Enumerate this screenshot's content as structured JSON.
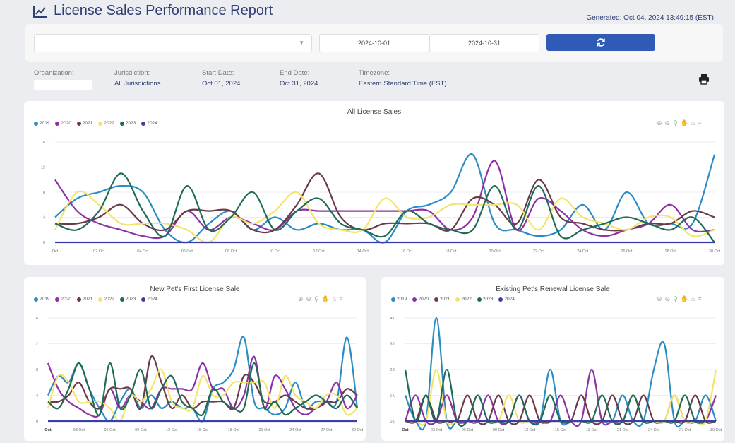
{
  "header": {
    "title": "License Sales Performance Report",
    "generated": "Generated: Oct 04, 2024 13:49:15 (EST)"
  },
  "filters": {
    "start_date_value": "2024-10-01",
    "end_date_value": "2024-10-31"
  },
  "meta": {
    "organization_label": "Organization:",
    "jurisdiction_label": "Jurisdiction:",
    "jurisdiction_value": "All Jurisdictions",
    "start_label": "Start Date:",
    "start_value": "Oct 01, 2024",
    "end_label": "End Date:",
    "end_value": "Oct 31, 2024",
    "timezone_label": "Timezone:",
    "timezone_value": "Eastern Standard Time (EST)"
  },
  "colors": {
    "2019": "#2b8cc4",
    "2020": "#8e30a8",
    "2021": "#6b3a4a",
    "2022": "#f2e56a",
    "2023": "#1f6b57",
    "2024": "#3a3ea8"
  },
  "chart_data": [
    {
      "type": "line",
      "title": "All License Sales",
      "x_ticks": [
        "Oct",
        "02 Oct",
        "04 Oct",
        "06 Oct",
        "08 Oct",
        "10 Oct",
        "12 Oct",
        "14 Oct",
        "16 Oct",
        "18 Oct",
        "20 Oct",
        "22 Oct",
        "24 Oct",
        "26 Oct",
        "28 Oct",
        "30 Oct"
      ],
      "y_ticks": [
        "0",
        "4",
        "8",
        "12",
        "16"
      ],
      "ylim": [
        0,
        16
      ],
      "x": [
        1,
        2,
        3,
        4,
        5,
        6,
        7,
        8,
        9,
        10,
        11,
        12,
        13,
        14,
        15,
        16,
        17,
        18,
        19,
        20,
        21,
        22,
        23,
        24,
        25,
        26,
        27,
        28,
        29,
        30,
        31
      ],
      "series": [
        {
          "name": "2019",
          "values": [
            4,
            7,
            8,
            9,
            8,
            2,
            0,
            3,
            5,
            2,
            4,
            2,
            3,
            2,
            2,
            0,
            5,
            6,
            8,
            14,
            3,
            2,
            1,
            2,
            6,
            2,
            8,
            3,
            3,
            3,
            14
          ]
        },
        {
          "name": "2020",
          "values": [
            10,
            5,
            3,
            2,
            1,
            1,
            5,
            2,
            4,
            3,
            2,
            5,
            5,
            5,
            5,
            5,
            5,
            5,
            2,
            4,
            13,
            2,
            7,
            5,
            2,
            1,
            2,
            3,
            6,
            2,
            2
          ]
        },
        {
          "name": "2021",
          "values": [
            3,
            3,
            4,
            6,
            3,
            2,
            5,
            5,
            5,
            2,
            2,
            6,
            11,
            4,
            2,
            3,
            3,
            3,
            2,
            7,
            6,
            3,
            10,
            4,
            3,
            2,
            2,
            3,
            3,
            5,
            4
          ]
        },
        {
          "name": "2022",
          "values": [
            2,
            8,
            6,
            3,
            3,
            3,
            2,
            0,
            4,
            3,
            5,
            8,
            3,
            2,
            2,
            7,
            4,
            4,
            6,
            6,
            6,
            6,
            2,
            7,
            4,
            3,
            2,
            4,
            4,
            1,
            2
          ]
        },
        {
          "name": "2023",
          "values": [
            3,
            2,
            5,
            11,
            5,
            1,
            9,
            2,
            4,
            8,
            2,
            5,
            7,
            3,
            2,
            1,
            5,
            3,
            2,
            2,
            9,
            2,
            9,
            1,
            2,
            3,
            4,
            3,
            2,
            4,
            0
          ]
        },
        {
          "name": "2024",
          "values": [
            0,
            0,
            0,
            0,
            0,
            0,
            0,
            0,
            0,
            0,
            0,
            0,
            0,
            0,
            0,
            0,
            0,
            0,
            0,
            0,
            0,
            0,
            0,
            0,
            0,
            0,
            0,
            0,
            0,
            0,
            0
          ]
        }
      ]
    },
    {
      "type": "line",
      "title": "New Pet's First License Sale",
      "x_ticks": [
        "Oct",
        "03 Oct",
        "06 Oct",
        "09 Oct",
        "12 Oct",
        "15 Oct",
        "18 Oct",
        "21 Oct",
        "24 Oct",
        "27 Oct",
        "30 Oct"
      ],
      "y_ticks": [
        "0",
        "4",
        "8",
        "12",
        "16"
      ],
      "ylim": [
        0,
        16
      ],
      "x": [
        1,
        2,
        3,
        4,
        5,
        6,
        7,
        8,
        9,
        10,
        11,
        12,
        13,
        14,
        15,
        16,
        17,
        18,
        19,
        20,
        21,
        22,
        23,
        24,
        25,
        26,
        27,
        28,
        29,
        30,
        31
      ],
      "series": [
        {
          "name": "2019",
          "values": [
            4,
            7,
            6,
            9,
            5,
            2,
            0,
            3,
            5,
            2,
            4,
            2,
            3,
            2,
            2,
            0,
            5,
            6,
            8,
            13,
            3,
            2,
            1,
            2,
            6,
            2,
            3,
            3,
            3,
            13,
            2
          ]
        },
        {
          "name": "2020",
          "values": [
            9,
            5,
            3,
            2,
            1,
            1,
            5,
            2,
            4,
            3,
            2,
            5,
            5,
            5,
            5,
            9,
            5,
            5,
            2,
            4,
            10,
            2,
            7,
            5,
            2,
            1,
            2,
            3,
            6,
            2,
            4
          ]
        },
        {
          "name": "2021",
          "values": [
            3,
            3,
            4,
            6,
            3,
            2,
            5,
            5,
            5,
            2,
            10,
            6,
            2,
            4,
            2,
            3,
            3,
            3,
            2,
            7,
            6,
            3,
            3,
            4,
            3,
            2,
            2,
            3,
            3,
            5,
            4
          ]
        },
        {
          "name": "2022",
          "values": [
            2,
            7,
            6,
            3,
            3,
            3,
            2,
            0,
            4,
            3,
            5,
            8,
            3,
            2,
            2,
            7,
            4,
            4,
            6,
            6,
            6,
            6,
            2,
            7,
            4,
            3,
            2,
            4,
            4,
            1,
            2
          ]
        },
        {
          "name": "2023",
          "values": [
            3,
            2,
            5,
            9,
            5,
            1,
            9,
            2,
            4,
            8,
            2,
            5,
            7,
            3,
            2,
            1,
            5,
            3,
            2,
            2,
            9,
            2,
            3,
            1,
            2,
            3,
            4,
            3,
            2,
            4,
            2
          ]
        },
        {
          "name": "2024",
          "values": [
            0,
            0,
            0,
            0,
            0,
            0,
            0,
            0,
            0,
            0,
            0,
            0,
            0,
            0,
            0,
            0,
            0,
            0,
            0,
            0,
            0,
            0,
            0,
            0,
            0,
            0,
            0,
            0,
            0,
            0,
            0
          ]
        }
      ]
    },
    {
      "type": "line",
      "title": "Existing Pet's Renewal License Sale",
      "x_ticks": [
        "Oct",
        "03 Oct",
        "06 Oct",
        "09 Oct",
        "12 Oct",
        "15 Oct",
        "18 Oct",
        "21 Oct",
        "24 Oct",
        "27 Oct",
        "30 Oct"
      ],
      "y_ticks": [
        "0.0",
        "1.0",
        "2.0",
        "3.0",
        "4.0"
      ],
      "ylim": [
        0,
        4
      ],
      "x": [
        1,
        2,
        3,
        4,
        5,
        6,
        7,
        8,
        9,
        10,
        11,
        12,
        13,
        14,
        15,
        16,
        17,
        18,
        19,
        20,
        21,
        22,
        23,
        24,
        25,
        26,
        27,
        28,
        29,
        30,
        31
      ],
      "series": [
        {
          "name": "2019",
          "values": [
            1,
            0,
            0,
            4,
            0,
            0,
            0,
            1,
            0,
            0,
            0,
            0,
            0,
            0,
            2,
            0,
            0,
            0,
            0,
            0,
            0,
            1,
            0,
            0,
            2,
            3,
            0,
            0,
            0,
            1,
            0
          ]
        },
        {
          "name": "2020",
          "values": [
            0,
            1,
            0,
            0,
            1,
            0,
            0,
            0,
            1,
            0,
            0,
            1,
            0,
            0,
            0,
            1,
            0,
            0,
            2,
            0,
            0,
            0,
            1,
            0,
            0,
            0,
            1,
            0,
            0,
            0,
            1
          ]
        },
        {
          "name": "2021",
          "values": [
            0,
            0,
            1,
            0,
            0,
            0,
            1,
            0,
            0,
            1,
            0,
            0,
            1,
            0,
            0,
            0,
            0,
            1,
            0,
            0,
            1,
            0,
            0,
            1,
            0,
            0,
            0,
            0,
            1,
            0,
            0
          ]
        },
        {
          "name": "2022",
          "values": [
            0,
            0,
            0,
            2,
            0,
            0,
            0,
            0,
            0,
            0,
            1,
            0,
            0,
            0,
            0,
            0,
            0,
            0,
            0,
            0,
            0,
            0,
            0,
            0,
            0,
            0,
            1,
            0,
            0,
            0,
            2
          ]
        },
        {
          "name": "2023",
          "values": [
            2,
            0,
            1,
            0,
            2,
            0,
            0,
            1,
            0,
            0,
            0,
            1,
            0,
            0,
            1,
            0,
            0,
            0,
            0,
            1,
            0,
            0,
            1,
            0,
            0,
            0,
            0,
            1,
            0,
            0,
            0
          ]
        },
        {
          "name": "2024",
          "values": [
            0,
            0,
            0,
            0,
            0,
            0,
            0,
            0,
            0,
            0,
            0,
            0,
            0,
            0,
            0,
            0,
            0,
            0,
            0,
            0,
            0,
            0,
            0,
            0,
            0,
            0,
            0,
            0,
            0,
            0,
            0
          ]
        }
      ]
    }
  ],
  "icons": {
    "title": "line-chart-icon",
    "refresh": "refresh-icon",
    "print": "printer-icon",
    "toolbar": [
      "zoom-in-icon",
      "zoom-out-icon",
      "zoom-select-icon",
      "pan-icon",
      "home-icon",
      "menu-icon"
    ]
  }
}
